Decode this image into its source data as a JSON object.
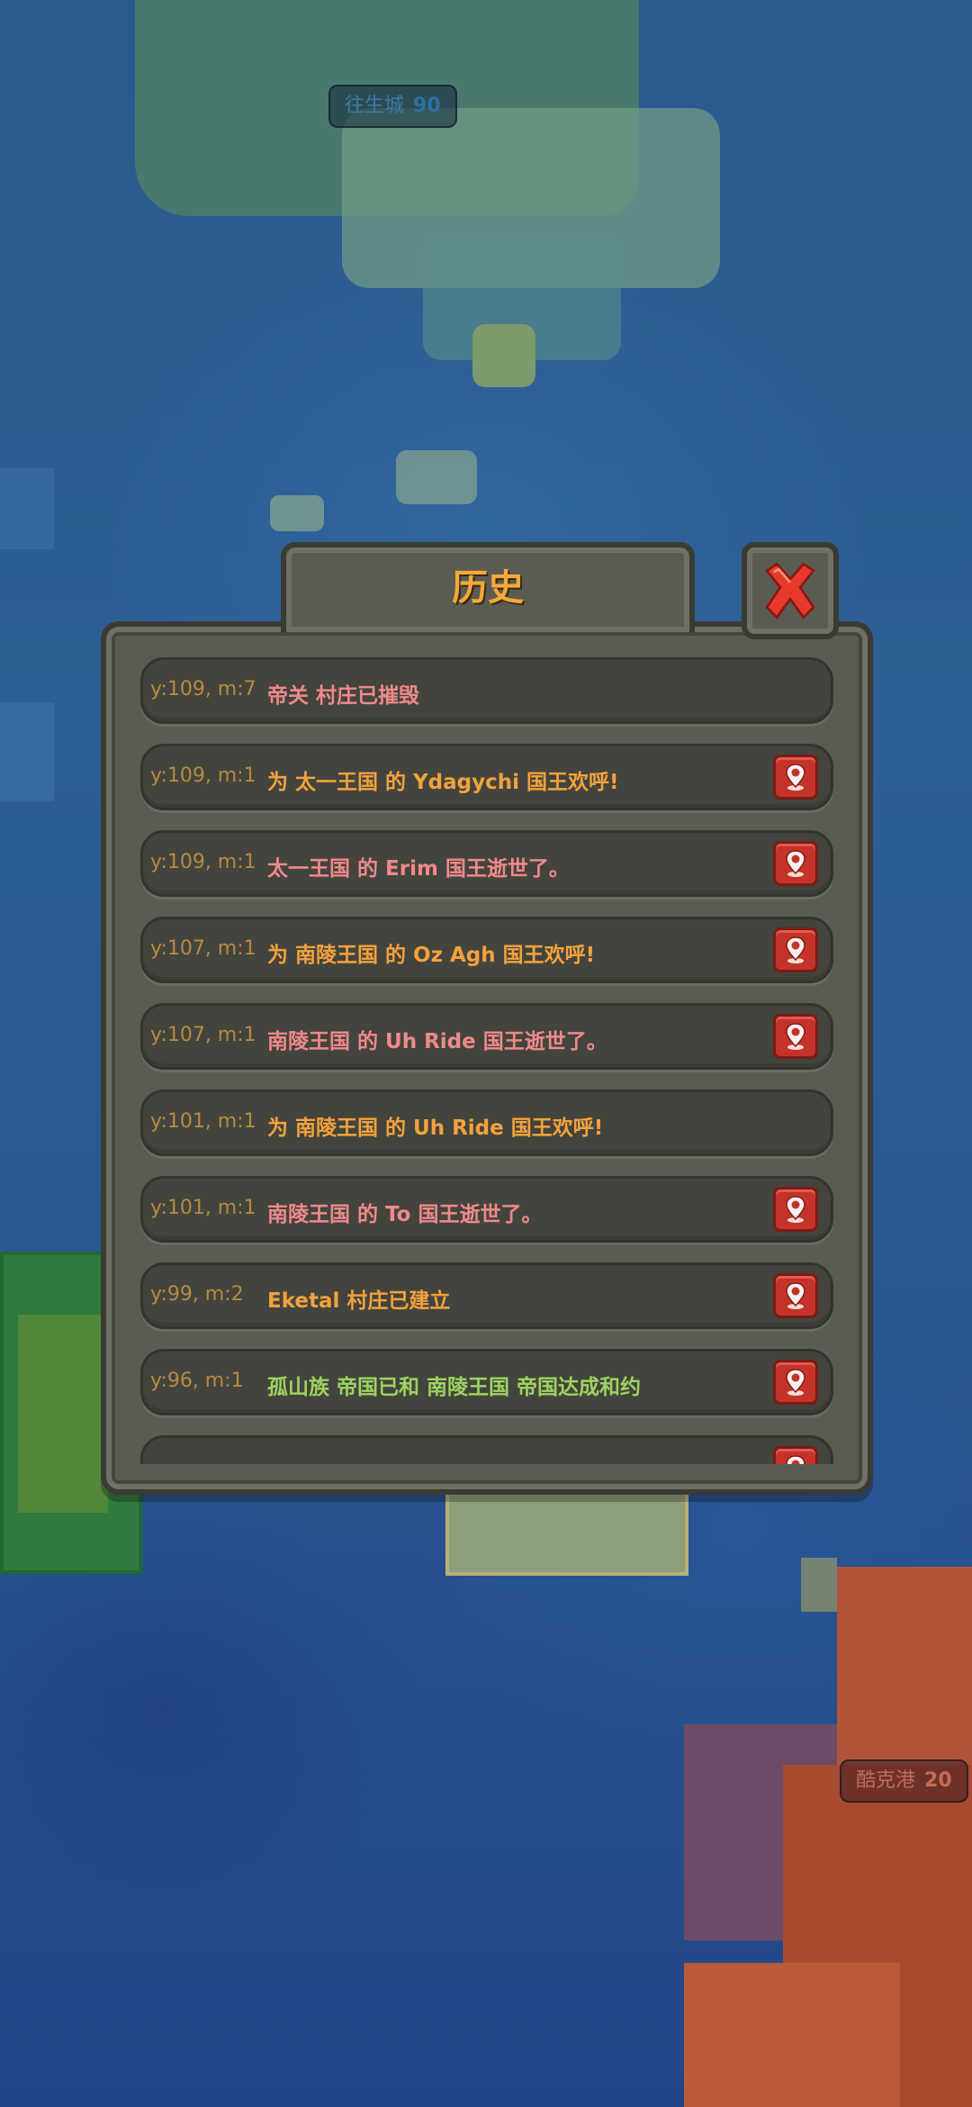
{
  "map_labels": [
    {
      "name": "往生城",
      "value": "90"
    },
    {
      "name": "酷克港",
      "value": "20"
    }
  ],
  "window": {
    "title": "历史",
    "close_icon": "close-x-icon"
  },
  "colors": {
    "date": "#b88a3f",
    "pink": "#f0898a",
    "orange": "#f4a23c",
    "green": "#9ed35f",
    "title": "#f7a83a"
  },
  "history": [
    {
      "date": "y:109, m:7",
      "text": "帝关 村庄已摧毁",
      "color": "pink",
      "has_pin": false
    },
    {
      "date": "y:109, m:1",
      "text": "为 太一王国 的 Ydagychi 国王欢呼!",
      "color": "orange",
      "has_pin": true
    },
    {
      "date": "y:109, m:1",
      "text": "太一王国 的 Erim 国王逝世了。",
      "color": "pink",
      "has_pin": true
    },
    {
      "date": "y:107, m:1",
      "text": "为 南陵王国 的 Oz Agh 国王欢呼!",
      "color": "orange",
      "has_pin": true
    },
    {
      "date": "y:107, m:1",
      "text": "南陵王国 的 Uh Ride 国王逝世了。",
      "color": "pink",
      "has_pin": true
    },
    {
      "date": "y:101, m:1",
      "text": "为 南陵王国 的 Uh Ride 国王欢呼!",
      "color": "orange",
      "has_pin": false
    },
    {
      "date": "y:101, m:1",
      "text": "南陵王国 的 To 国王逝世了。",
      "color": "pink",
      "has_pin": true
    },
    {
      "date": "y:99, m:2",
      "text": "Eketal 村庄已建立",
      "color": "orange",
      "has_pin": true
    },
    {
      "date": "y:96, m:1",
      "text": "孤山族 帝国已和 南陵王国 帝国达成和约",
      "color": "green",
      "has_pin": true
    },
    {
      "date": "",
      "text": "",
      "color": "orange",
      "has_pin": true
    }
  ]
}
